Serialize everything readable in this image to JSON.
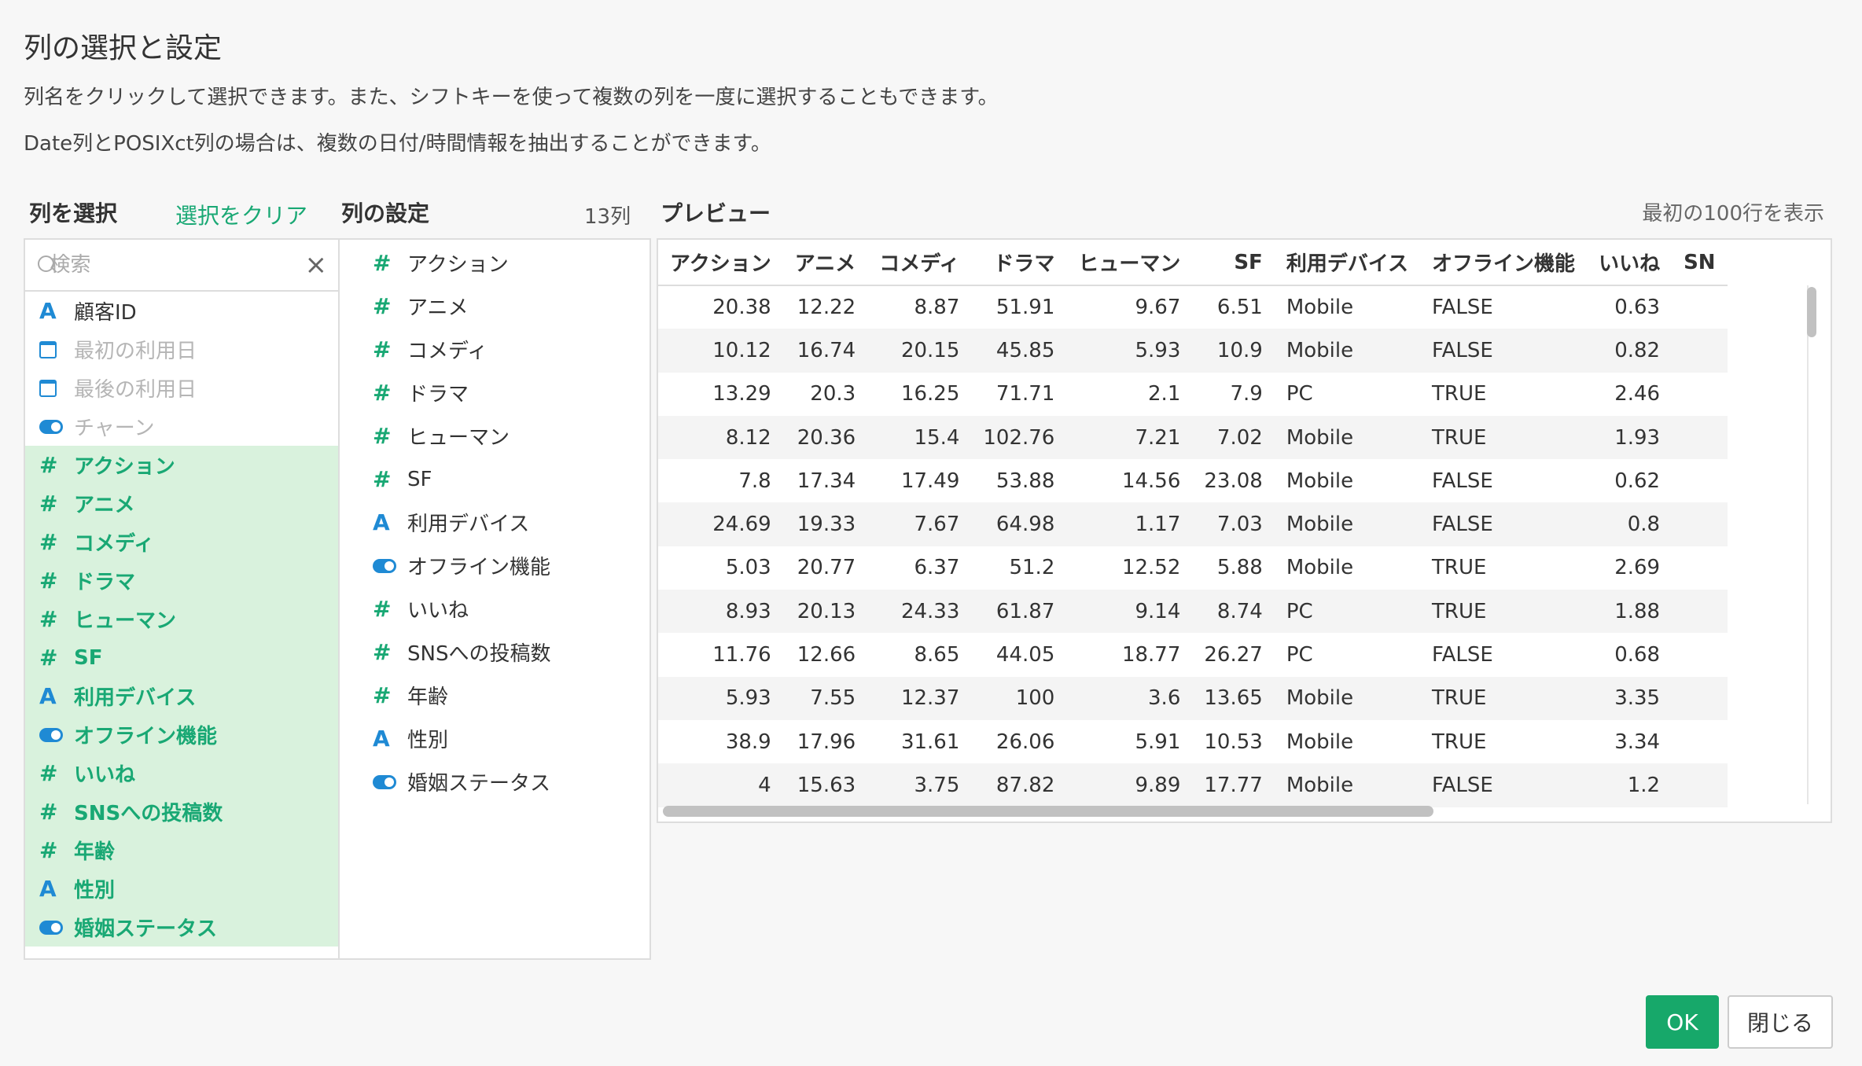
{
  "dialog": {
    "title": "列の選択と設定",
    "desc1": "列名をクリックして選択できます。また、シフトキーを使って複数の列を一度に選択することもできます。",
    "desc2": "Date列とPOSIXct列の場合は、複数の日付/時間情報を抽出することができます。"
  },
  "select": {
    "heading": "列を選択",
    "clear_label": "選択をクリア",
    "search_placeholder": "検索",
    "clear_icon": "×",
    "items": [
      {
        "icon": "text",
        "label": "顧客ID",
        "state": "normal"
      },
      {
        "icon": "calendar",
        "label": "最初の利用日",
        "state": "disabled"
      },
      {
        "icon": "calendar",
        "label": "最後の利用日",
        "state": "disabled"
      },
      {
        "icon": "toggle",
        "label": "チャーン",
        "state": "disabled"
      },
      {
        "icon": "number",
        "label": "アクション",
        "state": "selected"
      },
      {
        "icon": "number",
        "label": "アニメ",
        "state": "selected"
      },
      {
        "icon": "number",
        "label": "コメディ",
        "state": "selected"
      },
      {
        "icon": "number",
        "label": "ドラマ",
        "state": "selected"
      },
      {
        "icon": "number",
        "label": "ヒューマン",
        "state": "selected"
      },
      {
        "icon": "number",
        "label": "SF",
        "state": "selected"
      },
      {
        "icon": "text",
        "label": "利用デバイス",
        "state": "selected"
      },
      {
        "icon": "toggle",
        "label": "オフライン機能",
        "state": "selected"
      },
      {
        "icon": "number",
        "label": "いいね",
        "state": "selected"
      },
      {
        "icon": "number",
        "label": "SNSへの投稿数",
        "state": "selected"
      },
      {
        "icon": "number",
        "label": "年齢",
        "state": "selected"
      },
      {
        "icon": "text",
        "label": "性別",
        "state": "selected"
      },
      {
        "icon": "toggle",
        "label": "婚姻ステータス",
        "state": "selected"
      }
    ]
  },
  "settings": {
    "heading": "列の設定",
    "count": "13列",
    "items": [
      {
        "icon": "number",
        "label": "アクション"
      },
      {
        "icon": "number",
        "label": "アニメ"
      },
      {
        "icon": "number",
        "label": "コメディ"
      },
      {
        "icon": "number",
        "label": "ドラマ"
      },
      {
        "icon": "number",
        "label": "ヒューマン"
      },
      {
        "icon": "number",
        "label": "SF"
      },
      {
        "icon": "text",
        "label": "利用デバイス"
      },
      {
        "icon": "toggle",
        "label": "オフライン機能"
      },
      {
        "icon": "number",
        "label": "いいね"
      },
      {
        "icon": "number",
        "label": "SNSへの投稿数"
      },
      {
        "icon": "number",
        "label": "年齢"
      },
      {
        "icon": "text",
        "label": "性別"
      },
      {
        "icon": "toggle",
        "label": "婚姻ステータス"
      }
    ]
  },
  "preview": {
    "heading": "プレビュー",
    "rows_note": "最初の100行を表示",
    "columns": [
      {
        "label": "アクション",
        "align": "num"
      },
      {
        "label": "アニメ",
        "align": "num"
      },
      {
        "label": "コメディ",
        "align": "num"
      },
      {
        "label": "ドラマ",
        "align": "num"
      },
      {
        "label": "ヒューマン",
        "align": "num"
      },
      {
        "label": "SF",
        "align": "num"
      },
      {
        "label": "利用デバイス",
        "align": "txt"
      },
      {
        "label": "オフライン機能",
        "align": "txt"
      },
      {
        "label": "いいね",
        "align": "num"
      },
      {
        "label": "SN",
        "align": "txt"
      }
    ],
    "rows": [
      [
        "20.38",
        "12.22",
        "8.87",
        "51.91",
        "9.67",
        "6.51",
        "Mobile",
        "FALSE",
        "0.63",
        ""
      ],
      [
        "10.12",
        "16.74",
        "20.15",
        "45.85",
        "5.93",
        "10.9",
        "Mobile",
        "FALSE",
        "0.82",
        ""
      ],
      [
        "13.29",
        "20.3",
        "16.25",
        "71.71",
        "2.1",
        "7.9",
        "PC",
        "TRUE",
        "2.46",
        ""
      ],
      [
        "8.12",
        "20.36",
        "15.4",
        "102.76",
        "7.21",
        "7.02",
        "Mobile",
        "TRUE",
        "1.93",
        ""
      ],
      [
        "7.8",
        "17.34",
        "17.49",
        "53.88",
        "14.56",
        "23.08",
        "Mobile",
        "FALSE",
        "0.62",
        ""
      ],
      [
        "24.69",
        "19.33",
        "7.67",
        "64.98",
        "1.17",
        "7.03",
        "Mobile",
        "FALSE",
        "0.8",
        ""
      ],
      [
        "5.03",
        "20.77",
        "6.37",
        "51.2",
        "12.52",
        "5.88",
        "Mobile",
        "TRUE",
        "2.69",
        ""
      ],
      [
        "8.93",
        "20.13",
        "24.33",
        "61.87",
        "9.14",
        "8.74",
        "PC",
        "TRUE",
        "1.88",
        ""
      ],
      [
        "11.76",
        "12.66",
        "8.65",
        "44.05",
        "18.77",
        "26.27",
        "PC",
        "FALSE",
        "0.68",
        ""
      ],
      [
        "5.93",
        "7.55",
        "12.37",
        "100",
        "3.6",
        "13.65",
        "Mobile",
        "TRUE",
        "3.35",
        ""
      ],
      [
        "38.9",
        "17.96",
        "31.61",
        "26.06",
        "5.91",
        "10.53",
        "Mobile",
        "TRUE",
        "3.34",
        ""
      ],
      [
        "4",
        "15.63",
        "3.75",
        "87.82",
        "9.89",
        "17.77",
        "Mobile",
        "FALSE",
        "1.2",
        ""
      ]
    ]
  },
  "buttons": {
    "ok": "OK",
    "close": "閉じる"
  },
  "colors": {
    "accent_green": "#19a874",
    "type_blue": "#1f8ad4",
    "selected_bg": "#d9f2dd"
  }
}
